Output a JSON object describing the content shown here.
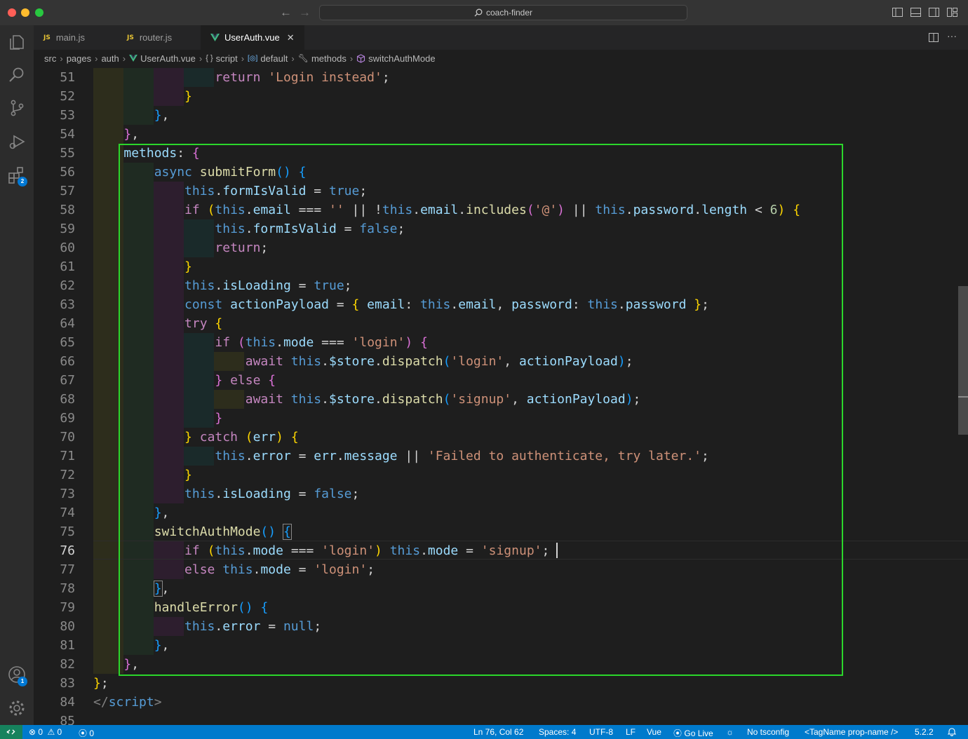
{
  "window": {
    "search_text": "coach-finder"
  },
  "tabs": [
    {
      "label": "main.js",
      "icon": "JS"
    },
    {
      "label": "router.js",
      "icon": "JS"
    },
    {
      "label": "UserAuth.vue",
      "icon": "vue-icon",
      "active": true
    }
  ],
  "breadcrumb": {
    "src": "src",
    "pages": "pages",
    "auth": "auth",
    "file": "UserAuth.vue",
    "script": "script",
    "default": "default",
    "methods": "methods",
    "symbol": "switchAuthMode"
  },
  "badges": {
    "extensions": "2",
    "accounts": "1"
  },
  "editor": {
    "line_numbers": [
      "51",
      "52",
      "53",
      "54",
      "55",
      "56",
      "57",
      "58",
      "59",
      "60",
      "61",
      "62",
      "63",
      "64",
      "65",
      "66",
      "67",
      "68",
      "69",
      "70",
      "71",
      "72",
      "73",
      "74",
      "75",
      "76",
      "77",
      "78",
      "79",
      "80",
      "81",
      "82",
      "83",
      "84",
      "85"
    ],
    "current_line": "76"
  },
  "status": {
    "errors": "0",
    "warnings": "0",
    "ports": "0",
    "position": "Ln 76, Col 62",
    "spaces": "Spaces: 4",
    "encoding": "UTF-8",
    "eol": "LF",
    "language": "Vue",
    "go_live": "Go Live",
    "tsconfig": "No tsconfig",
    "snippet": "<TagName prop-name />",
    "version": "5.2.2"
  },
  "colors": {
    "accent": "#007acc",
    "highlight_box": "#2bd62b",
    "remote": "#16825d"
  }
}
